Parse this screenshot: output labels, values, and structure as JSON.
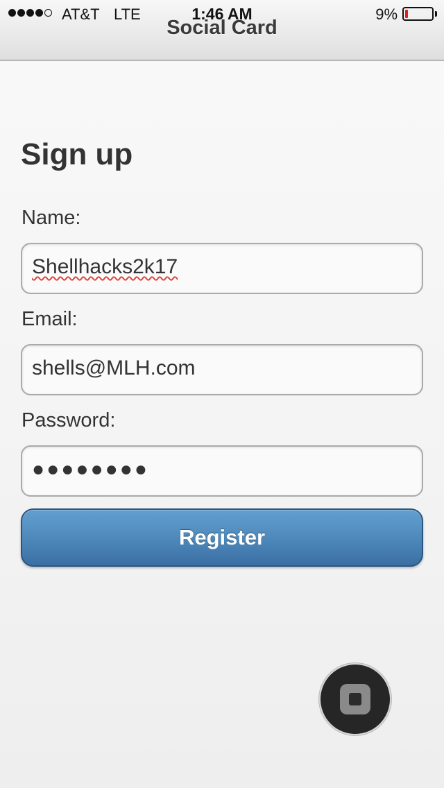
{
  "status_bar": {
    "carrier": "AT&T",
    "network": "LTE",
    "time": "1:46 AM",
    "battery_percent": "9%",
    "battery_level": 0.09,
    "signal_bars_filled": 4,
    "signal_bars_total": 5
  },
  "header": {
    "title": "Social Card"
  },
  "form": {
    "heading": "Sign up",
    "name_label": "Name:",
    "name_value": "Shellhacks2k17",
    "email_label": "Email:",
    "email_value": "shells@MLH.com",
    "password_label": "Password:",
    "password_value": "●●●●●●●●",
    "register_label": "Register"
  },
  "colors": {
    "accent": "#4f89bb",
    "battery_low": "#e0201e",
    "spellcheck": "#e0443a"
  },
  "icons": {
    "assistive_touch": "assistive-touch-icon"
  }
}
